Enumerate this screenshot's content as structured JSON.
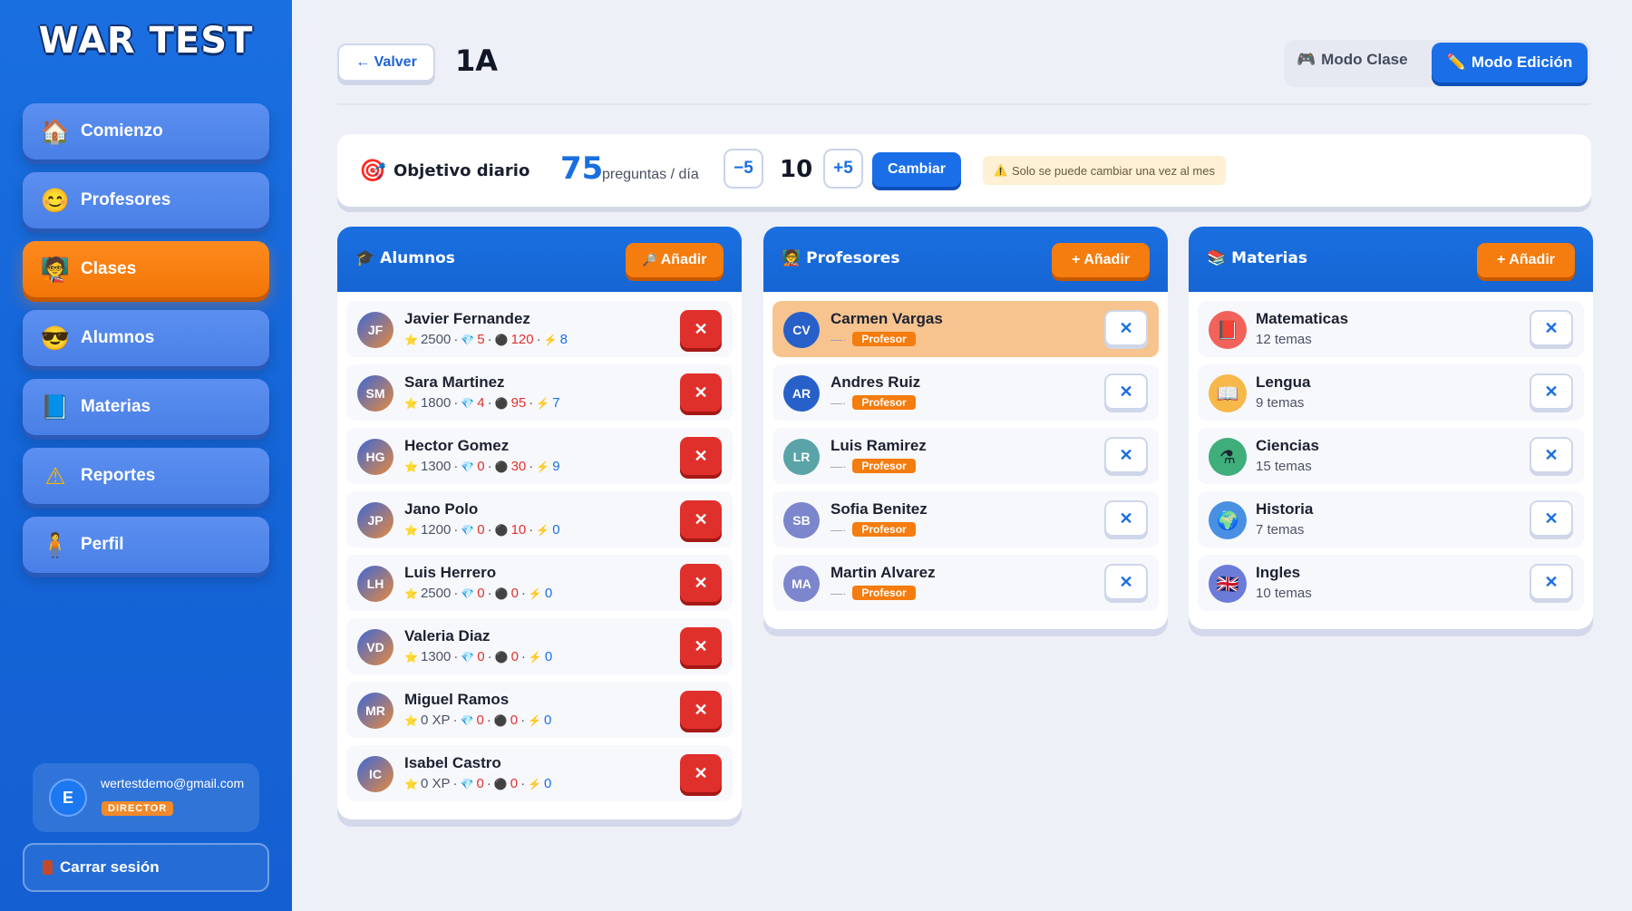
{
  "app": {
    "logo": "WAR TEST"
  },
  "sidebar": {
    "items": [
      {
        "label": "Comienzo",
        "icon": "🏠"
      },
      {
        "label": "Profesores",
        "icon": "😊"
      },
      {
        "label": "Clases",
        "icon": "🧑‍🏫"
      },
      {
        "label": "Alumnos",
        "icon": "😎"
      },
      {
        "label": "Materias",
        "icon": "📘"
      },
      {
        "label": "Reportes",
        "icon": "⚠"
      },
      {
        "label": "Perfil",
        "icon": "🧍"
      }
    ],
    "active_index": 2,
    "user": {
      "initial": "E",
      "email": "wertestdemo@gmail.com",
      "role": "DIRECTOR"
    },
    "logout_label": "Carrar sesión"
  },
  "header": {
    "back_label": "← Valver",
    "class_title": "1A",
    "mode_clase_label": "Modo Clase",
    "mode_clase_icon": "🎮",
    "mode_edit_label": "Modo Edición",
    "mode_edit_icon": "✏️"
  },
  "objective": {
    "icon": "🎯",
    "label": "Objetivo diario",
    "value": "75",
    "unit": "preguntas / día",
    "minus_label": "−5",
    "step_value": "10",
    "plus_label": "+5",
    "change_label": "Cambiar",
    "warning": "Solo se puede cambiar una vez al mes",
    "warning_icon": "⚠️"
  },
  "alumnos": {
    "title": "Alumnos",
    "title_icon": "🎓",
    "add_label": "Añadir",
    "add_icon": "🔎",
    "rows": [
      {
        "initials": "JF",
        "name": "Javier Fernandez",
        "xp": "2500",
        "gems": "5",
        "coins": "120",
        "bolts": "8"
      },
      {
        "initials": "SM",
        "name": "Sara Martinez",
        "xp": "1800",
        "gems": "4",
        "coins": "95",
        "bolts": "7"
      },
      {
        "initials": "HG",
        "name": "Hector Gomez",
        "xp": "1300",
        "gems": "0",
        "coins": "30",
        "bolts": "9"
      },
      {
        "initials": "JP",
        "name": "Jano Polo",
        "xp": "1200",
        "gems": "0",
        "coins": "10",
        "bolts": "0"
      },
      {
        "initials": "LH",
        "name": "Luis Herrero",
        "xp": "2500",
        "gems": "0",
        "coins": "0",
        "bolts": "0"
      },
      {
        "initials": "VD",
        "name": "Valeria Diaz",
        "xp": "1300",
        "gems": "0",
        "coins": "0",
        "bolts": "0"
      },
      {
        "initials": "MR",
        "name": "Miguel Ramos",
        "xp": "0 XP",
        "gems": "0",
        "coins": "0",
        "bolts": "0"
      },
      {
        "initials": "IC",
        "name": "Isabel Castro",
        "xp": "0 XP",
        "gems": "0",
        "coins": "0",
        "bolts": "0"
      }
    ],
    "delete_label": "✕"
  },
  "profesores": {
    "title": "Profesores",
    "title_icon": "🧑‍🏫",
    "add_label": "Añadir",
    "add_icon": "+",
    "rows": [
      {
        "initials": "CV",
        "name": "Carmen Vargas",
        "role": "Profesor",
        "dash": "—·"
      },
      {
        "initials": "AR",
        "name": "Andres Ruiz",
        "role": "Profesor",
        "dash": "—·"
      },
      {
        "initials": "LR",
        "name": "Luis Ramirez",
        "role": "Profesor",
        "dash": "—·"
      },
      {
        "initials": "SB",
        "name": "Sofia Benitez",
        "role": "Profesor",
        "dash": "—·"
      },
      {
        "initials": "MA",
        "name": "Martin Alvarez",
        "role": "Profesor",
        "dash": "—·"
      }
    ],
    "highlight_index": 0,
    "remove_label": "✕"
  },
  "materias": {
    "title": "Materias",
    "title_icon": "📚",
    "add_label": "Añadir",
    "add_icon": "+",
    "rows": [
      {
        "name": "Matematicas",
        "count": "12 temas",
        "icon": "📕",
        "color": "#f0625a"
      },
      {
        "name": "Lengua",
        "count": "9 temas",
        "icon": "📖",
        "color": "#f6b84a"
      },
      {
        "name": "Ciencias",
        "count": "15 temas",
        "icon": "⚗",
        "color": "#3fae7a"
      },
      {
        "name": "Historia",
        "count": "7 temas",
        "icon": "🌍",
        "color": "#4a90e2"
      },
      {
        "name": "Ingles",
        "count": "10 temas",
        "icon": "🇬🇧",
        "color": "#6b7bd8"
      }
    ],
    "remove_label": "✕"
  },
  "colors": {
    "primary": "#1a6fe0",
    "accent": "#f57c0e",
    "danger": "#e0302c",
    "background": "#eef0f8"
  }
}
